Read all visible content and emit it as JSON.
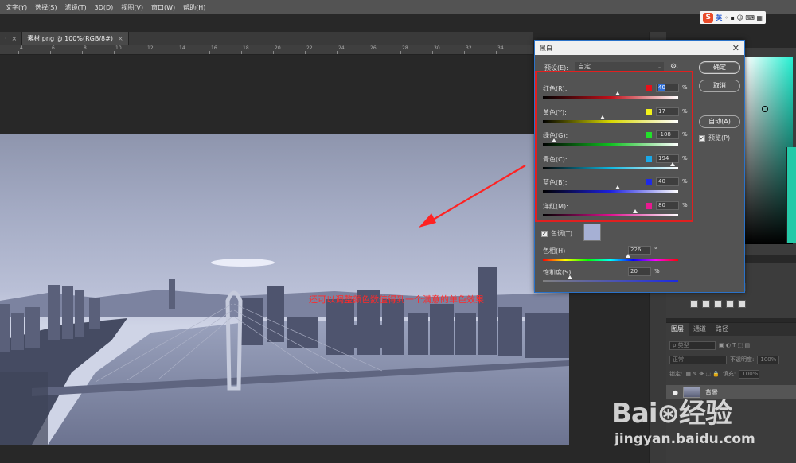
{
  "menubar": {
    "items": [
      "文字(Y)",
      "选择(S)",
      "滤镜(T)",
      "3D(D)",
      "视图(V)",
      "窗口(W)",
      "帮助(H)"
    ]
  },
  "ime": {
    "logo": "S",
    "lang": "英"
  },
  "tabs": [
    {
      "label": "·",
      "active": false
    },
    {
      "label": "素材.png @ 100%(RGB/8#)",
      "active": true
    }
  ],
  "ruler": {
    "labels": [
      "4",
      "6",
      "8",
      "10",
      "12",
      "14",
      "16",
      "18",
      "20",
      "22",
      "24",
      "26",
      "28",
      "30",
      "32",
      "34"
    ]
  },
  "annotation": {
    "text": "还可以调整颜色数值得到一个满意的单色效果"
  },
  "dialog": {
    "title": "黑白",
    "close": "✕",
    "preset_label": "预设(E):",
    "preset_value": "自定",
    "ok": "确定",
    "cancel": "取消",
    "auto": "自动(A)",
    "preview": "预览(P)",
    "preview_checked": true,
    "sliders": [
      {
        "label": "红色(R):",
        "value": "40",
        "percent": "%",
        "color": "#e8101a",
        "fraction": 0.55,
        "selected": true,
        "gradient": "linear-gradient(to right,#000,#c0101a,#fff)"
      },
      {
        "label": "黄色(Y):",
        "value": "17",
        "percent": "%",
        "color": "#f2f21a",
        "fraction": 0.44,
        "selected": false,
        "gradient": "linear-gradient(to right,#000,#d8d800,#fff)"
      },
      {
        "label": "绿色(G):",
        "value": "-108",
        "percent": "%",
        "color": "#22e02a",
        "fraction": 0.08,
        "selected": false,
        "gradient": "linear-gradient(to right,#000,#10c020,#fff)"
      },
      {
        "label": "青色(C):",
        "value": "194",
        "percent": "%",
        "color": "#1aa8e8",
        "fraction": 0.96,
        "selected": false,
        "gradient": "linear-gradient(to right,#000,#10b8e0,#fff)"
      },
      {
        "label": "蓝色(B):",
        "value": "40",
        "percent": "%",
        "color": "#1e2ae8",
        "fraction": 0.55,
        "selected": false,
        "gradient": "linear-gradient(to right,#000,#1c20e0,#fff)"
      },
      {
        "label": "洋红(M):",
        "value": "80",
        "percent": "%",
        "color": "#e81a90",
        "fraction": 0.68,
        "selected": false,
        "gradient": "linear-gradient(to right,#000,#e01090,#fff)"
      }
    ],
    "tint": {
      "label": "色调(T)",
      "checked": true,
      "swatch_color": "#a6b0d4",
      "hue_label": "色相(H)",
      "hue_value": "226",
      "hue_unit": "°",
      "hue_fraction": 0.63,
      "sat_label": "饱和度(S)",
      "sat_value": "20",
      "sat_unit": "%",
      "sat_fraction": 0.2
    }
  },
  "layers": {
    "tabs": [
      "图层",
      "通道",
      "路径"
    ],
    "kind_label": "ρ 类型",
    "blend_mode": "正常",
    "opacity_label": "不透明度:",
    "opacity_value": "100%",
    "lock_label": "锁定:",
    "fill_label": "填充:",
    "fill_value": "100%",
    "background_layer": "背景"
  },
  "watermark": {
    "logo": "Bai⊛经验",
    "url": "jingyan.baidu.com"
  }
}
